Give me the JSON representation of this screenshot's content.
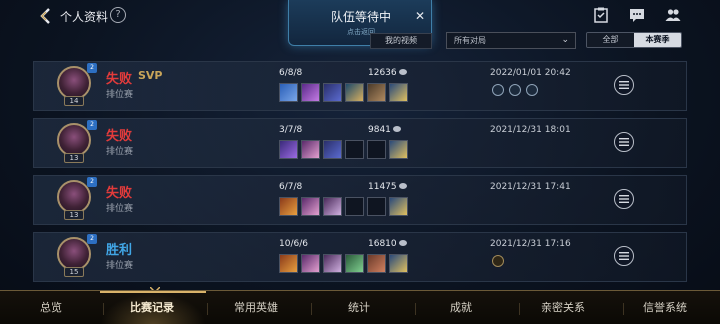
{
  "header": {
    "title": "个人资料",
    "help_icon": "?",
    "icons": [
      "task-icon",
      "chat-icon",
      "friends-icon"
    ]
  },
  "team_banner": {
    "title": "队伍等待中",
    "subtitle": "点击返回",
    "close_icon": "✕"
  },
  "filters": {
    "video_button": "我的视频",
    "time_select": "所有对局",
    "season_toggle": [
      "全部",
      "本赛季"
    ],
    "selected_toggle": "本赛季"
  },
  "matches": [
    {
      "result": "失败",
      "result_type": "loss",
      "svp": "SVP",
      "mode": "排位赛",
      "level": "14",
      "kda": "6/8/8",
      "gold": "12636",
      "date": "2022/01/01 20:42",
      "items": 6,
      "medals": 3
    },
    {
      "result": "失败",
      "result_type": "loss",
      "svp": "",
      "mode": "排位赛",
      "level": "13",
      "kda": "3/7/8",
      "gold": "9841",
      "date": "2021/12/31 18:01",
      "items": 3,
      "medals": 0
    },
    {
      "result": "失败",
      "result_type": "loss",
      "svp": "",
      "mode": "排位赛",
      "level": "13",
      "kda": "6/7/8",
      "gold": "11475",
      "date": "2021/12/31 17:41",
      "items": 3,
      "medals": 0
    },
    {
      "result": "胜利",
      "result_type": "win",
      "svp": "",
      "mode": "排位赛",
      "level": "15",
      "kda": "10/6/6",
      "gold": "16810",
      "date": "2021/12/31 17:16",
      "items": 6,
      "medals": 1
    }
  ],
  "bottom_nav": {
    "tabs": [
      "总览",
      "比赛记录",
      "常用英雄",
      "统计",
      "成就",
      "亲密关系",
      "信誉系统"
    ],
    "active": "比赛记录"
  },
  "colors": {
    "loss": "#e23b3b",
    "win": "#41a6e6",
    "svp": "#c9a55a",
    "accent_gold": "#d9b36a"
  }
}
